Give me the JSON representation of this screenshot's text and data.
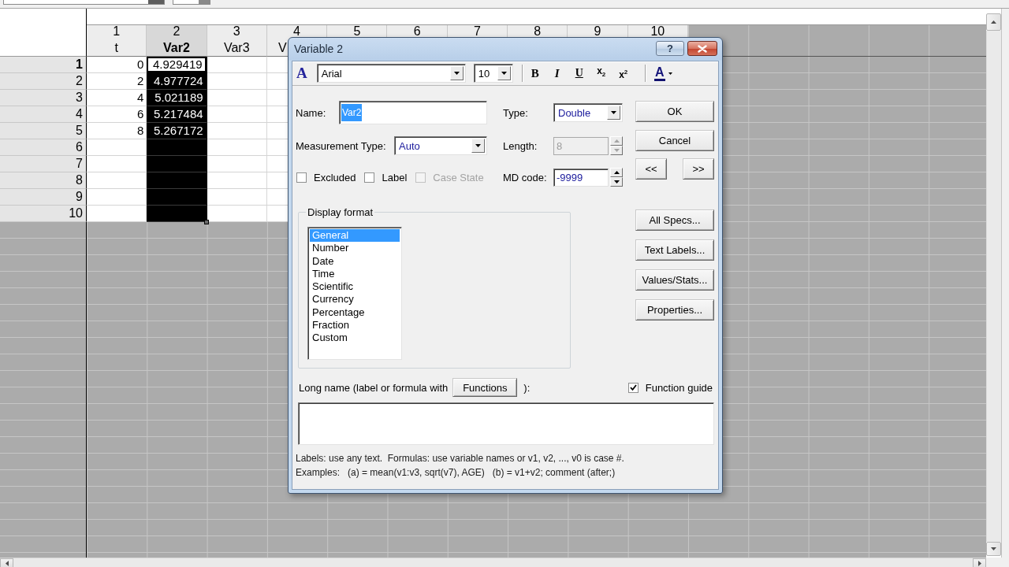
{
  "spreadsheet": {
    "columns": [
      {
        "number": "1",
        "name": "t",
        "selected": false,
        "cut_off": false
      },
      {
        "number": "2",
        "name": "Var2",
        "selected": true,
        "cut_off": false
      },
      {
        "number": "3",
        "name": "Var3",
        "selected": false,
        "cut_off": false
      },
      {
        "number": "4",
        "name": "V",
        "selected": false,
        "cut_off": true
      },
      {
        "number": "5",
        "selected": false
      },
      {
        "number": "6",
        "selected": false
      },
      {
        "number": "7",
        "selected": false
      },
      {
        "number": "8",
        "selected": false
      },
      {
        "number": "9",
        "selected": false
      },
      {
        "number": "10",
        "selected": false
      }
    ],
    "rows": [
      {
        "number": "1",
        "current": true,
        "cells": [
          "0",
          "4.929419"
        ]
      },
      {
        "number": "2",
        "current": false,
        "cells": [
          "2",
          "4.977724"
        ]
      },
      {
        "number": "3",
        "current": false,
        "cells": [
          "4",
          "5.021189"
        ]
      },
      {
        "number": "4",
        "current": false,
        "cells": [
          "6",
          "5.217484"
        ]
      },
      {
        "number": "5",
        "current": false,
        "cells": [
          "8",
          "5.267172"
        ]
      },
      {
        "number": "6",
        "current": false
      },
      {
        "number": "7",
        "current": false
      },
      {
        "number": "8",
        "current": false
      },
      {
        "number": "9",
        "current": false
      },
      {
        "number": "10",
        "current": false
      }
    ]
  },
  "dialog": {
    "title": "Variable 2",
    "help_button": "?",
    "toolbar": {
      "font_icon": "A",
      "font": "Arial",
      "size": "10",
      "format_buttons": [
        {
          "kind": "bold",
          "label": "B"
        },
        {
          "kind": "italic",
          "label": "I"
        },
        {
          "kind": "underline",
          "label": "U"
        },
        {
          "kind": "subscript",
          "label": "x$_{2}$"
        },
        {
          "kind": "superscript",
          "label": "x$^{2}$"
        }
      ],
      "font_color_button": "A"
    },
    "name": {
      "label": "Name:",
      "value": "Var2",
      "text_selected": true
    },
    "type": {
      "label": "Type:",
      "value": "Double"
    },
    "measurement_type": {
      "label": "Measurement Type:",
      "value": "Auto"
    },
    "length": {
      "label": "Length:",
      "value": "8",
      "disabled": true
    },
    "checkboxes": [
      {
        "label": "Excluded",
        "checked": false,
        "disabled": false
      },
      {
        "label": "Label",
        "checked": false,
        "disabled": false
      },
      {
        "label": "Case State",
        "checked": false,
        "disabled": true
      }
    ],
    "md_code": {
      "label": "MD code:",
      "value": "-9999",
      "disabled": false
    },
    "buttons": [
      "OK",
      "Cancel"
    ],
    "nav_buttons": [
      "<<",
      ">>"
    ],
    "display_format": {
      "title": "Display format",
      "items": [
        {
          "label": "General",
          "selected": true
        },
        {
          "label": "Number",
          "selected": false
        },
        {
          "label": "Date",
          "selected": false
        },
        {
          "label": "Time",
          "selected": false
        },
        {
          "label": "Scientific",
          "selected": false
        },
        {
          "label": "Currency",
          "selected": false
        },
        {
          "label": "Percentage",
          "selected": false
        },
        {
          "label": "Fraction",
          "selected": false
        },
        {
          "label": "Custom",
          "selected": false
        }
      ]
    },
    "side_buttons": [
      "All Specs...",
      "Text Labels...",
      "Values/Stats...",
      "Properties..."
    ],
    "long_name": {
      "label": "Long name (label or formula with",
      "button": "Functions",
      "label_end": "):"
    },
    "function_guide": {
      "label": "Function guide",
      "checked": true
    },
    "help_lines": [
      "Labels: use any text.  Formulas: use variable names or v1, v2, ..., v0 is case #.",
      "Examples:   (a) = mean(v1:v3, sqrt(v7), AGE)   (b) = v1+v2; comment (after;)"
    ]
  }
}
